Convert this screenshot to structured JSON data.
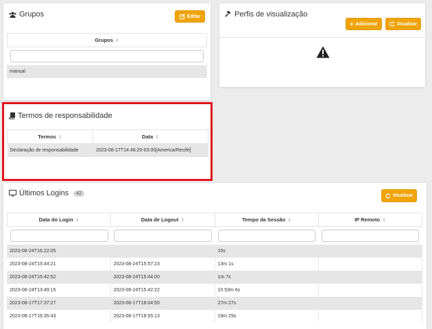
{
  "grupos": {
    "title": "Grupos",
    "edit_label": "Editar",
    "column": "Grupos",
    "filter_placeholder": "",
    "rows": [
      "manual"
    ]
  },
  "perfis": {
    "title": "Perfis de visualização",
    "add_label": "Adicionar",
    "refresh_label": "Atualizar"
  },
  "termos": {
    "title": "Termos de responsabilidade",
    "columns": [
      "Termos",
      "Data"
    ],
    "rows": [
      [
        "Declaração de responsabilidade",
        "2023-08-17T14:48:20-03:00[America/Recife]"
      ]
    ]
  },
  "logins": {
    "title": "Últimos Logins",
    "count": "42",
    "refresh_label": "Atualizar",
    "columns": [
      "Data do Login",
      "Data de Logout",
      "Tempo da Sessão",
      "IP Remoto"
    ],
    "rows": [
      [
        "2023-08-24T16:22:05",
        "",
        "15s",
        ""
      ],
      [
        "2023-08-24T15:44:21",
        "2023-08-24T15:57:23",
        "13m 1s",
        ""
      ],
      [
        "2023-08-24T15:42:52",
        "2023-08-24T15:44:00",
        "1m 7s",
        ""
      ],
      [
        "2023-08-24T13:49:15",
        "2023-08-24T15:42:22",
        "1h 53m 6s",
        ""
      ],
      [
        "2023-08-17T17:37:27",
        "2023-08-17T18:04:55",
        "27m 27s",
        ""
      ],
      [
        "2023-08-17T16:35:43",
        "2023-08-17T18:55:13",
        "19m 29s",
        ""
      ]
    ]
  },
  "colors": {
    "accent": "#f0a30a",
    "highlight": "#e0141e"
  }
}
